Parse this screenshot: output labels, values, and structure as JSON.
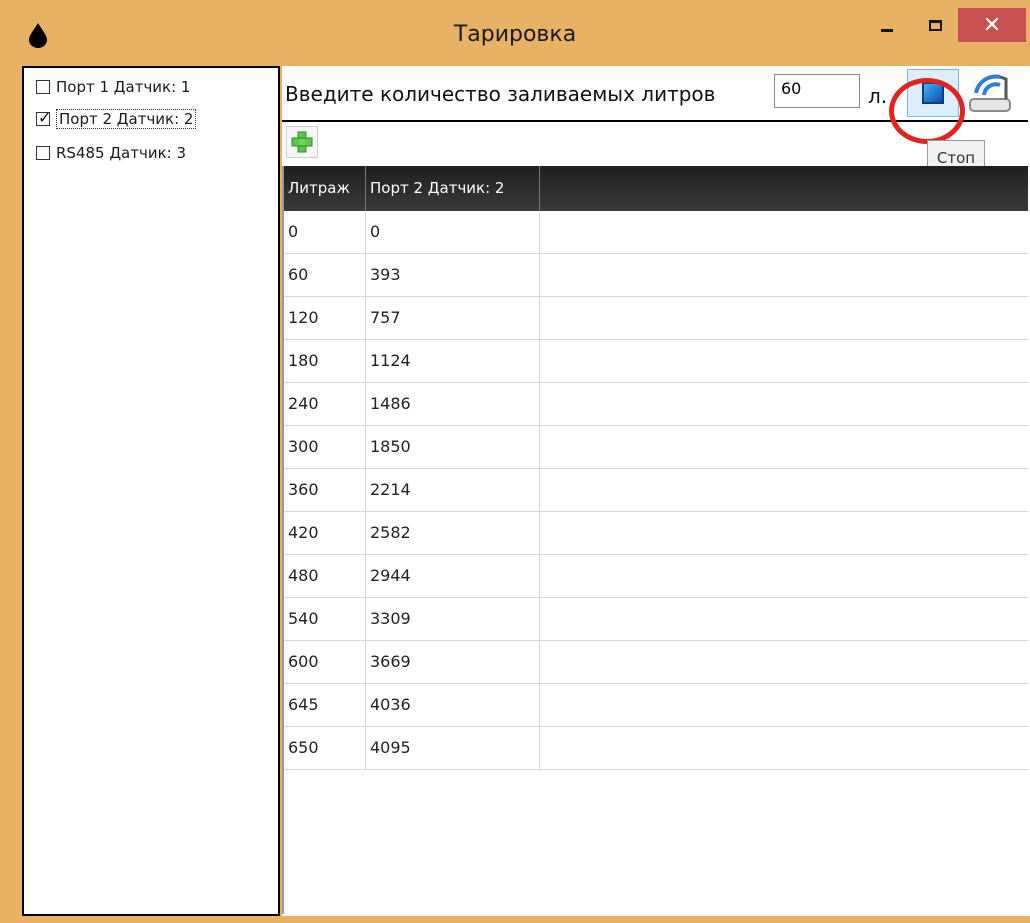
{
  "window": {
    "title": "Тарировка",
    "accent_color": "#e8b265",
    "close_color": "#c75050",
    "icons": {
      "app": "drop-icon",
      "minimize": "minimize-icon",
      "maximize": "maximize-icon",
      "close": "close-icon"
    }
  },
  "sensors": {
    "items": [
      {
        "label": "Порт 1 Датчик: 1",
        "checked": false
      },
      {
        "label": "Порт 2 Датчик: 2",
        "checked": true
      },
      {
        "label": "RS485 Датчик: 3",
        "checked": false
      }
    ]
  },
  "toolbar": {
    "prompt": "Введите количество заливаемых литров",
    "liters_value": "60",
    "unit": "л.",
    "stop_tooltip": "Стоп",
    "icons": {
      "stop": "stop-icon",
      "connect": "wireless-connect-icon",
      "add": "add-row-icon"
    },
    "highlight_color": "#e0241e"
  },
  "grid": {
    "columns": [
      "Литраж",
      "Порт 2 Датчик: 2"
    ],
    "rows": [
      [
        "0",
        "0"
      ],
      [
        "60",
        "393"
      ],
      [
        "120",
        "757"
      ],
      [
        "180",
        "1124"
      ],
      [
        "240",
        "1486"
      ],
      [
        "300",
        "1850"
      ],
      [
        "360",
        "2214"
      ],
      [
        "420",
        "2582"
      ],
      [
        "480",
        "2944"
      ],
      [
        "540",
        "3309"
      ],
      [
        "600",
        "3669"
      ],
      [
        "645",
        "4036"
      ],
      [
        "650",
        "4095"
      ]
    ]
  }
}
